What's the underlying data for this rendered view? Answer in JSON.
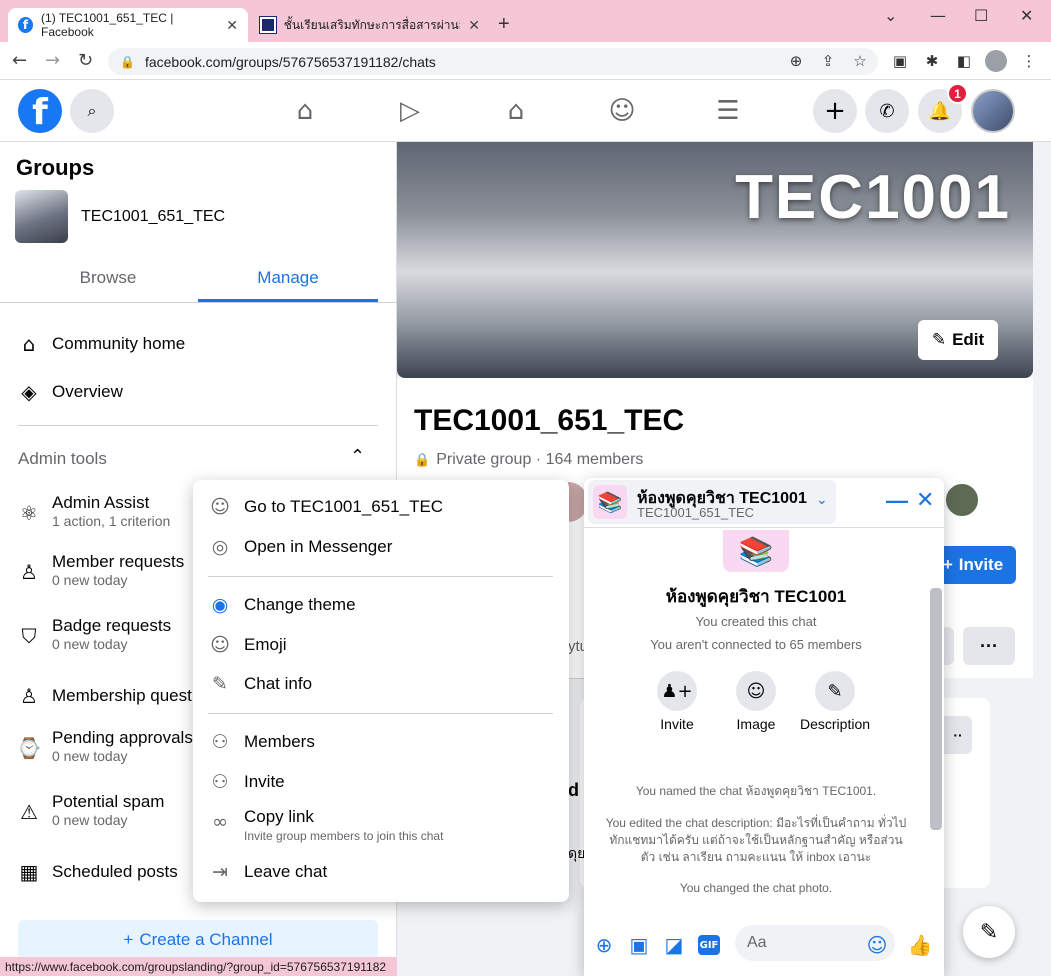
{
  "browser": {
    "tabs": [
      {
        "title": "(1) TEC1001_651_TEC | Facebook"
      },
      {
        "title": "ชั้นเรียนเสริมทักษะการสื่อสารผ่านสื่อสั..."
      }
    ],
    "url": "facebook.com/groups/576756537191182/chats",
    "status_url": "https://www.facebook.com/groupslanding/?group_id=576756537191182"
  },
  "header": {
    "notification_count": "1"
  },
  "sidebar": {
    "title": "Groups",
    "group_name": "TEC1001_651_TEC",
    "tabs": [
      {
        "label": "Browse"
      },
      {
        "label": "Manage"
      }
    ],
    "nav": [
      {
        "label": "Community home"
      },
      {
        "label": "Overview"
      }
    ],
    "admin_tools_label": "Admin tools",
    "admin_items": [
      {
        "label": "Admin Assist",
        "sub": "1 action, 1 criterion"
      },
      {
        "label": "Member requests",
        "sub": "0 new today"
      },
      {
        "label": "Badge requests",
        "sub": "0 new today"
      },
      {
        "label": "Membership quest",
        "sub": ""
      },
      {
        "label": "Pending approvals",
        "sub": "0 new today"
      },
      {
        "label": "Potential spam",
        "sub": "0 new today"
      },
      {
        "label": "Scheduled posts",
        "sub": ""
      }
    ],
    "create_channel": "Create a Channel"
  },
  "main": {
    "cover_title": "TEC1001",
    "edit_label": "Edit",
    "group_name": "TEC1001_651_TEC",
    "group_meta": "Private group · 164 members",
    "invite_label": "Invite",
    "more_label": "···",
    "peek_text_1": "d",
    "peek_text_2": "ดุย",
    "peek_text_3": "ytu"
  },
  "menu": {
    "items": [
      {
        "label": "Go to TEC1001_651_TEC",
        "sub": ""
      },
      {
        "label": "Open in Messenger",
        "sub": ""
      },
      {
        "label": "Change theme",
        "sub": ""
      },
      {
        "label": "Emoji",
        "sub": ""
      },
      {
        "label": "Chat info",
        "sub": ""
      },
      {
        "label": "Members",
        "sub": ""
      },
      {
        "label": "Invite",
        "sub": ""
      },
      {
        "label": "Copy link",
        "sub": "Invite group members to join this chat"
      },
      {
        "label": "Leave chat",
        "sub": ""
      }
    ]
  },
  "chat": {
    "title": "ห้องพูดคุยวิชา TEC1001",
    "subtitle": "TEC1001_651_TEC",
    "name": "ห้องพูดคุยวิชา TEC1001",
    "created": "You created this chat",
    "connected": "You aren't connected to 65 members",
    "actions": [
      {
        "label": "Invite"
      },
      {
        "label": "Image"
      },
      {
        "label": "Description"
      }
    ],
    "events": [
      "You named the chat ห้องพูดคุยวิชา TEC1001.",
      "You edited the chat description: มีอะไรที่เป็นคำถาม ทั่วไป ทักแชทมาได้ครับ แต่ถ้าจะใช้เป็นหลักฐานสำคัญ หรือส่วนตัว เช่น ลาเรียน ถามคะแนน ให้ inbox เอานะ",
      "You changed the chat photo."
    ],
    "composer_placeholder": "Aa"
  },
  "colors": {
    "accent": "#1b74e4",
    "tabbar": "#f4c6d6",
    "badge": "#e41e3f"
  }
}
